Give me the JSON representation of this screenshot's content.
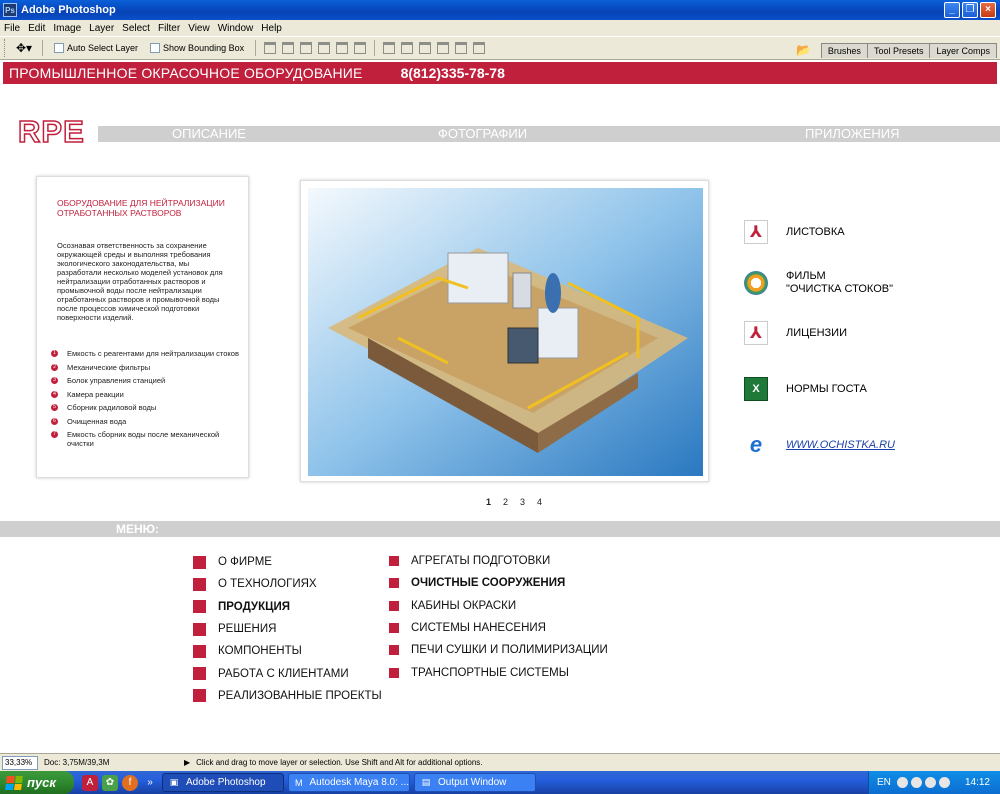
{
  "window": {
    "title": "Adobe Photoshop",
    "minimize": "_",
    "maximize": "❐",
    "close": "×"
  },
  "menu": [
    "File",
    "Edit",
    "Image",
    "Layer",
    "Select",
    "Filter",
    "View",
    "Window",
    "Help"
  ],
  "options": {
    "auto_select": "Auto Select Layer",
    "bounding_box": "Show Bounding Box"
  },
  "palette_tabs": [
    "Brushes",
    "Tool Presets",
    "Layer Comps"
  ],
  "site": {
    "company": "ПРОМЫШЛЕННОЕ ОКРАСОЧНОЕ ОБОРУДОВАНИЕ",
    "phone": "8(812)335-78-78",
    "logo": "RPE",
    "nav": [
      "ОПИСАНИЕ",
      "ФОТОГРАФИИ",
      "ПРИЛОЖЕНИЯ"
    ]
  },
  "left_panel": {
    "title": "ОБОРУДОВАНИЕ ДЛЯ НЕЙТРАЛИЗАЦИИ ОТРАБОТАННЫХ РАСТВОРОВ",
    "text": "Осознавая ответственность за сохранение окружающей среды и выполняя требования экологического законодательства, мы разработали несколько моделей  установок для нейтрализации отработанных растворов и промывочной воды после нейтрализации отработанных растворов и промывочной воды  после процессов химической подготовки  поверхности изделий.",
    "items": [
      {
        "n": "1",
        "label": "Емкость с реагентами для нейтрализации стоков"
      },
      {
        "n": "2",
        "label": "Механические фильтры"
      },
      {
        "n": "3",
        "label": "Болок управления станцией"
      },
      {
        "n": "4",
        "label": "Камера реакции"
      },
      {
        "n": "5",
        "label": "Сборник радиловой воды"
      },
      {
        "n": "6",
        "label": "Очищенная вода"
      },
      {
        "n": "7",
        "label": "Емкость сборник воды после механической очистки"
      }
    ]
  },
  "pager": [
    "1",
    "2",
    "3",
    "4"
  ],
  "downloads": [
    {
      "icon": "pdf-icon",
      "label": "ЛИСТОВКА"
    },
    {
      "icon": "media-player-icon",
      "label": "ФИЛЬМ\n\"ОЧИСТКА СТОКОВ\""
    },
    {
      "icon": "pdf-icon",
      "label": "ЛИЦЕНЗИИ"
    },
    {
      "icon": "excel-icon",
      "label": "НОРМЫ ГОСТА"
    },
    {
      "icon": "internet-explorer-icon",
      "label": "WWW.OCHISTKA.RU"
    }
  ],
  "menu_band": "МЕНЮ:",
  "menu_left": [
    {
      "label": "О ФИРМЕ",
      "bold": false
    },
    {
      "label": "О ТЕХНОЛОГИЯХ",
      "bold": false
    },
    {
      "label": "ПРОДУКЦИЯ",
      "bold": true
    },
    {
      "label": "РЕШЕНИЯ",
      "bold": false
    },
    {
      "label": "КОМПОНЕНТЫ",
      "bold": false
    },
    {
      "label": "РАБОТА С КЛИЕНТАМИ",
      "bold": false
    },
    {
      "label": "РЕАЛИЗОВАННЫЕ ПРОЕКТЫ",
      "bold": false
    }
  ],
  "menu_right": [
    {
      "label": "АГРЕГАТЫ ПОДГОТОВКИ",
      "bold": false
    },
    {
      "label": "ОЧИСТНЫЕ СООРУЖЕНИЯ",
      "bold": true
    },
    {
      "label": "КАБИНЫ ОКРАСКИ",
      "bold": false
    },
    {
      "label": "СИСТЕМЫ НАНЕСЕНИЯ",
      "bold": false
    },
    {
      "label": "ПЕЧИ СУШКИ И ПОЛИМИРИЗАЦИИ",
      "bold": false
    },
    {
      "label": "ТРАНСПОРТНЫЕ СИСТЕМЫ",
      "bold": false
    }
  ],
  "status": {
    "zoom": "33,33%",
    "doc": "Doc: 3,75M/39,3M",
    "hint": "Click and drag to move layer or selection.  Use Shift and Alt for additional options."
  },
  "taskbar": {
    "start": "пуск",
    "tasks": [
      "Adobe Photoshop",
      "Autodesk Maya 8.0: ...",
      "Output Window"
    ],
    "lang": "EN",
    "clock": "14:12"
  },
  "colors": {
    "brand_red": "#c0203c",
    "nav_gray": "#cfcfcf"
  }
}
